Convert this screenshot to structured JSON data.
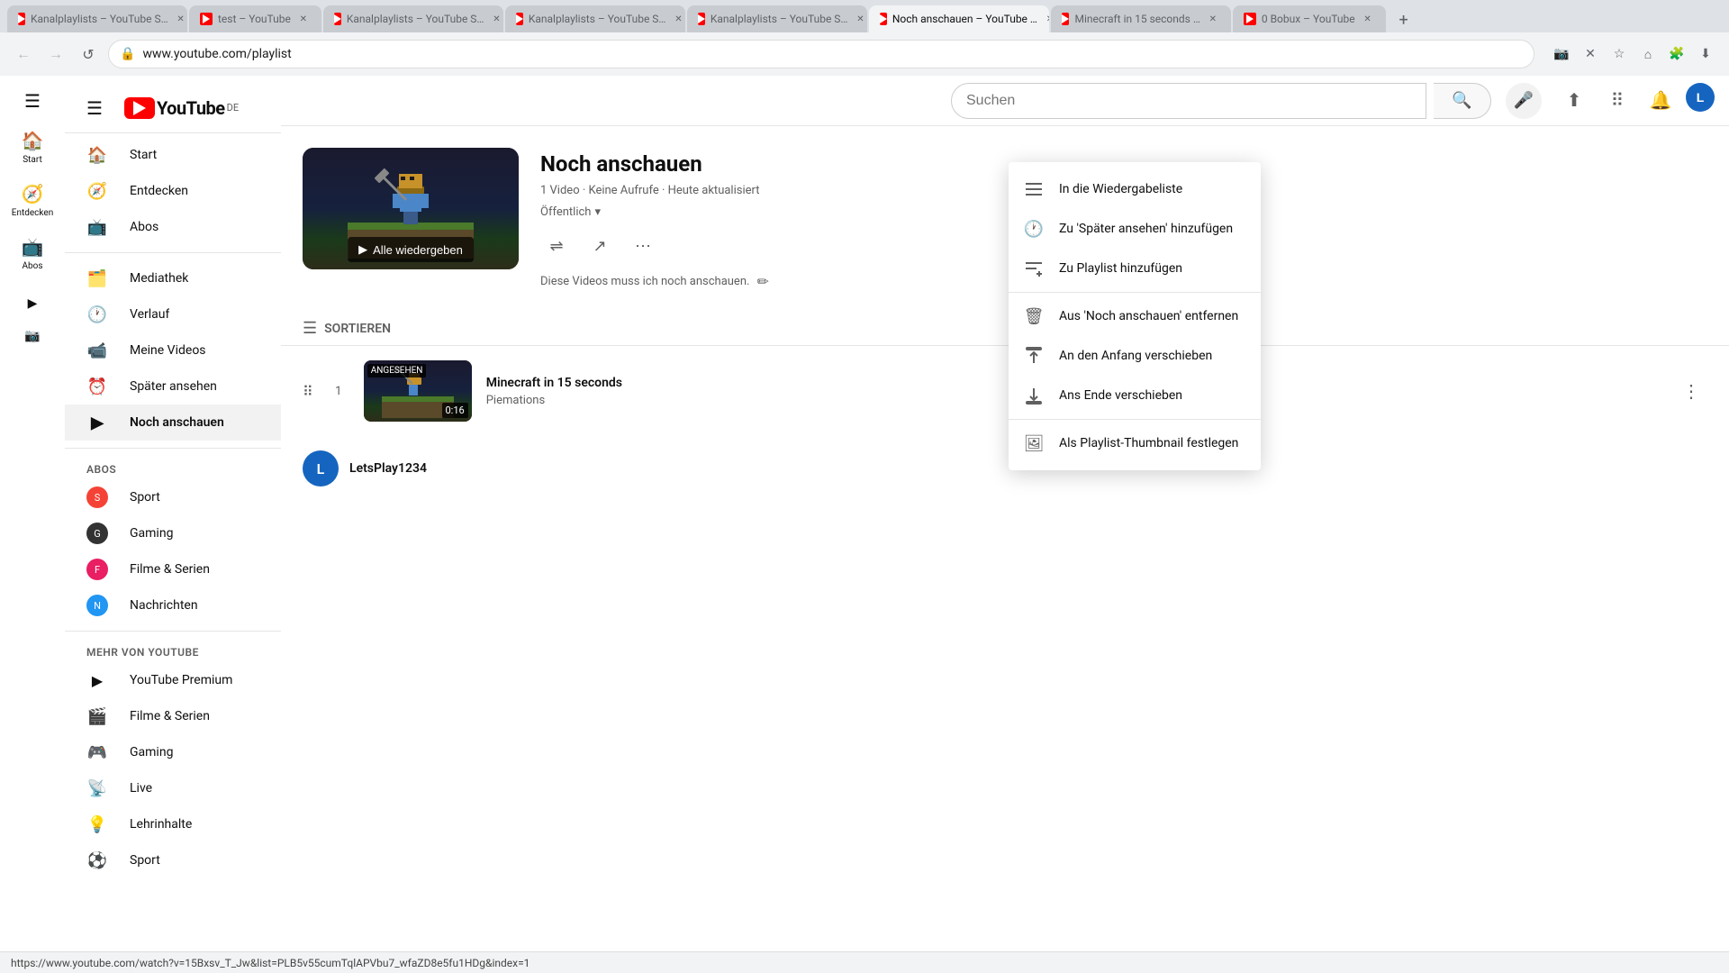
{
  "browser": {
    "tabs": [
      {
        "id": "tab1",
        "favicon": "yt",
        "title": "Kanalplaylists – YouTube S…",
        "active": false
      },
      {
        "id": "tab2",
        "favicon": "yt",
        "title": "test – YouTube",
        "active": false
      },
      {
        "id": "tab3",
        "favicon": "yt",
        "title": "Kanalplaylists – YouTube S…",
        "active": false
      },
      {
        "id": "tab4",
        "favicon": "yt",
        "title": "Kanalplaylists – YouTube S…",
        "active": false
      },
      {
        "id": "tab5",
        "favicon": "yt",
        "title": "Kanalplaylists – YouTube S…",
        "active": false
      },
      {
        "id": "tab6",
        "favicon": "yt",
        "title": "Noch anschauen – YouTube …",
        "active": true
      },
      {
        "id": "tab7",
        "favicon": "yt",
        "title": "Minecraft in 15 seconds …",
        "active": false
      },
      {
        "id": "tab8",
        "favicon": "yt",
        "title": "0 Bobux – YouTube",
        "active": false
      }
    ],
    "url": "www.youtube.com/playlist",
    "status_url": "https://www.youtube.com/watch?v=15Bxsv_T_Jw&list=PLB5v55cumTqlAPVbu7_wfaZD8e5fu1HDg&index=1"
  },
  "header": {
    "title": "YouTube",
    "country": "DE",
    "search_placeholder": "Suchen",
    "upload_icon": "⬆",
    "apps_icon": "⋮⋮⋮",
    "bell_icon": "🔔",
    "avatar_text": "L"
  },
  "sidebar_narrow": {
    "items": [
      {
        "id": "home",
        "icon": "🏠",
        "label": "Start"
      },
      {
        "id": "explore",
        "icon": "🧭",
        "label": "Entdecken"
      },
      {
        "id": "subs",
        "icon": "📺",
        "label": "Abos"
      },
      {
        "id": "yt2",
        "icon": "▶",
        "label": ""
      },
      {
        "id": "ig",
        "icon": "📸",
        "label": ""
      }
    ]
  },
  "sidebar": {
    "items": [
      {
        "id": "home",
        "icon": "🏠",
        "label": "Start"
      },
      {
        "id": "explore",
        "icon": "🧭",
        "label": "Entdecken"
      },
      {
        "id": "subs",
        "icon": "📺",
        "label": "Abos"
      }
    ],
    "library_items": [
      {
        "id": "library",
        "icon": "🗂️",
        "label": "Mediathek"
      },
      {
        "id": "history",
        "icon": "🕐",
        "label": "Verlauf"
      },
      {
        "id": "my_videos",
        "icon": "📹",
        "label": "Meine Videos"
      },
      {
        "id": "watch_later",
        "icon": "⏰",
        "label": "Später ansehen"
      },
      {
        "id": "liked",
        "icon": "▶",
        "label": "Noch anschauen",
        "active": true
      }
    ],
    "section_abos": "ABOS",
    "abos_items": [
      {
        "id": "sport",
        "label": "Sport",
        "color": "#f00"
      },
      {
        "id": "gaming",
        "label": "Gaming",
        "color": "#333"
      },
      {
        "id": "filme",
        "label": "Filme & Serien",
        "color": "#e91e63"
      },
      {
        "id": "nachrichten",
        "label": "Nachrichten",
        "color": "#2196f3"
      }
    ],
    "section_mehr": "MEHR VON YOUTUBE",
    "mehr_items": [
      {
        "id": "yt_premium",
        "icon": "▶",
        "label": "YouTube Premium"
      },
      {
        "id": "filme2",
        "icon": "🎬",
        "label": "Filme & Serien"
      },
      {
        "id": "gaming2",
        "icon": "🎮",
        "label": "Gaming"
      },
      {
        "id": "live",
        "icon": "📡",
        "label": "Live"
      },
      {
        "id": "lehrinhalte",
        "icon": "💡",
        "label": "Lehrinhalte"
      },
      {
        "id": "sport2",
        "icon": "⚽",
        "label": "Sport"
      }
    ]
  },
  "playlist": {
    "title": "Noch anschauen",
    "meta": "1 Video · Keine Aufrufe · Heute aktualisiert",
    "visibility": "Öffentlich",
    "description": "Diese Videos muss ich noch anschauen.",
    "play_all_label": "Alle wiedergeben",
    "contributor": "LetsPlay1234"
  },
  "sort": {
    "label": "SORTIEREN"
  },
  "video": {
    "title": "Minecraft in 15 seconds",
    "channel": "Piemations",
    "badge": "ANGESEHEN",
    "duration": "0:16",
    "number": "1"
  },
  "context_menu": {
    "items": [
      {
        "id": "add_queue",
        "icon": "☰",
        "label": "In die Wiedergabeliste"
      },
      {
        "id": "watch_later",
        "icon": "🕐",
        "label": "Zu 'Später ansehen' hinzufügen"
      },
      {
        "id": "add_playlist",
        "icon": "☰+",
        "label": "Zu Playlist hinzufügen"
      },
      {
        "id": "remove",
        "icon": "🗑",
        "label": "Aus 'Noch anschauen' entfernen"
      },
      {
        "id": "move_top",
        "icon": "T",
        "label": "An den Anfang verschieben"
      },
      {
        "id": "move_bottom",
        "icon": "⬇",
        "label": "Ans Ende verschieben"
      },
      {
        "id": "thumbnail",
        "icon": "🖼",
        "label": "Als Playlist-Thumbnail festlegen"
      }
    ]
  },
  "icons": {
    "hamburger": "☰",
    "search": "🔍",
    "mic": "🎤",
    "upload": "⬆",
    "apps": "⠿",
    "bell": "🔔",
    "back": "←",
    "forward": "→",
    "reload": "↺",
    "home_nav": "⌂",
    "lock": "🔒",
    "more_vert": "⋮",
    "edit": "✏",
    "shuffle": "⇌",
    "share": "↗",
    "more": "⋯",
    "drag": "⠿",
    "play": "▶"
  }
}
